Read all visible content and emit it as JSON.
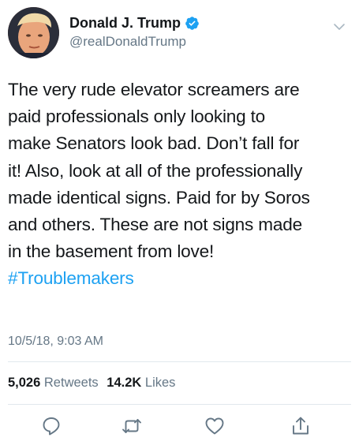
{
  "author": {
    "display_name": "Donald J. Trump",
    "handle": "@realDonaldTrump",
    "verified": true,
    "avatar_icon": "profile-photo"
  },
  "tweet": {
    "lines": [
      "The very rude elevator screamers are",
      "paid professionals only looking to",
      "make Senators look bad. Don’t fall for",
      "it! Also, look at all of the professionally",
      "made identical signs. Paid for by Soros",
      "and others. These are not signs made",
      "in the basement from love!"
    ],
    "hashtag": "#Troublemakers",
    "timestamp": "10/5/18, 9:03 AM"
  },
  "stats": {
    "retweets_count": "5,026",
    "retweets_label": "Retweets",
    "likes_count": "14.2K",
    "likes_label": "Likes"
  },
  "actions": [
    {
      "name": "reply",
      "icon": "reply-icon"
    },
    {
      "name": "retweet",
      "icon": "retweet-icon"
    },
    {
      "name": "like",
      "icon": "heart-icon"
    },
    {
      "name": "share",
      "icon": "share-icon"
    }
  ],
  "colors": {
    "text": "#14171a",
    "secondary": "#657786",
    "link": "#1da1f2",
    "verified_badge": "#1da1f2",
    "divider": "#e1e8ed"
  }
}
